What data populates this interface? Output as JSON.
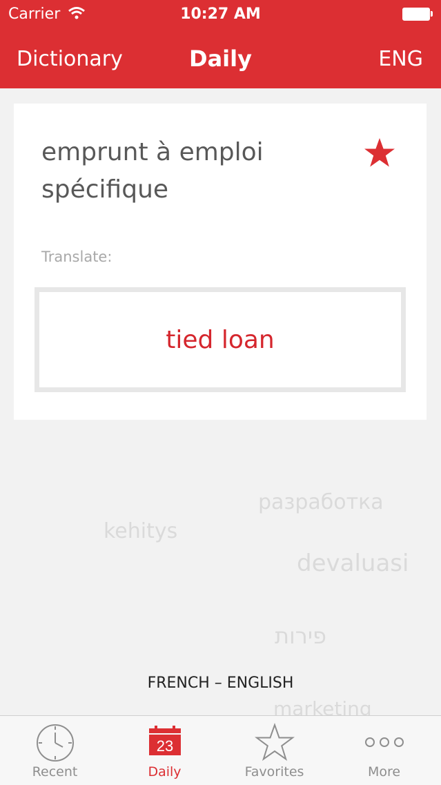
{
  "status_bar": {
    "carrier": "Carrier",
    "time": "10:27 AM"
  },
  "nav": {
    "left": "Dictionary",
    "title": "Daily",
    "right": "ENG"
  },
  "card": {
    "term": "emprunt à emploi spécifique",
    "favorited": true,
    "translate_label": "Translate:",
    "translation": "tied loan"
  },
  "background_words": [
    "разработка",
    "kehitys",
    "devaluasi",
    "פירות",
    "marketing"
  ],
  "language_pair": "FRENCH – ENGLISH",
  "tabs": [
    {
      "label": "Recent",
      "icon": "clock-icon"
    },
    {
      "label": "Daily",
      "icon": "calendar-icon",
      "badge": "23",
      "active": true
    },
    {
      "label": "Favorites",
      "icon": "star-outline-icon"
    },
    {
      "label": "More",
      "icon": "more-dots-icon"
    }
  ],
  "colors": {
    "accent": "#dc2f33",
    "tab_inactive": "#8e8e8e",
    "label_gray": "#a8a8a8"
  }
}
